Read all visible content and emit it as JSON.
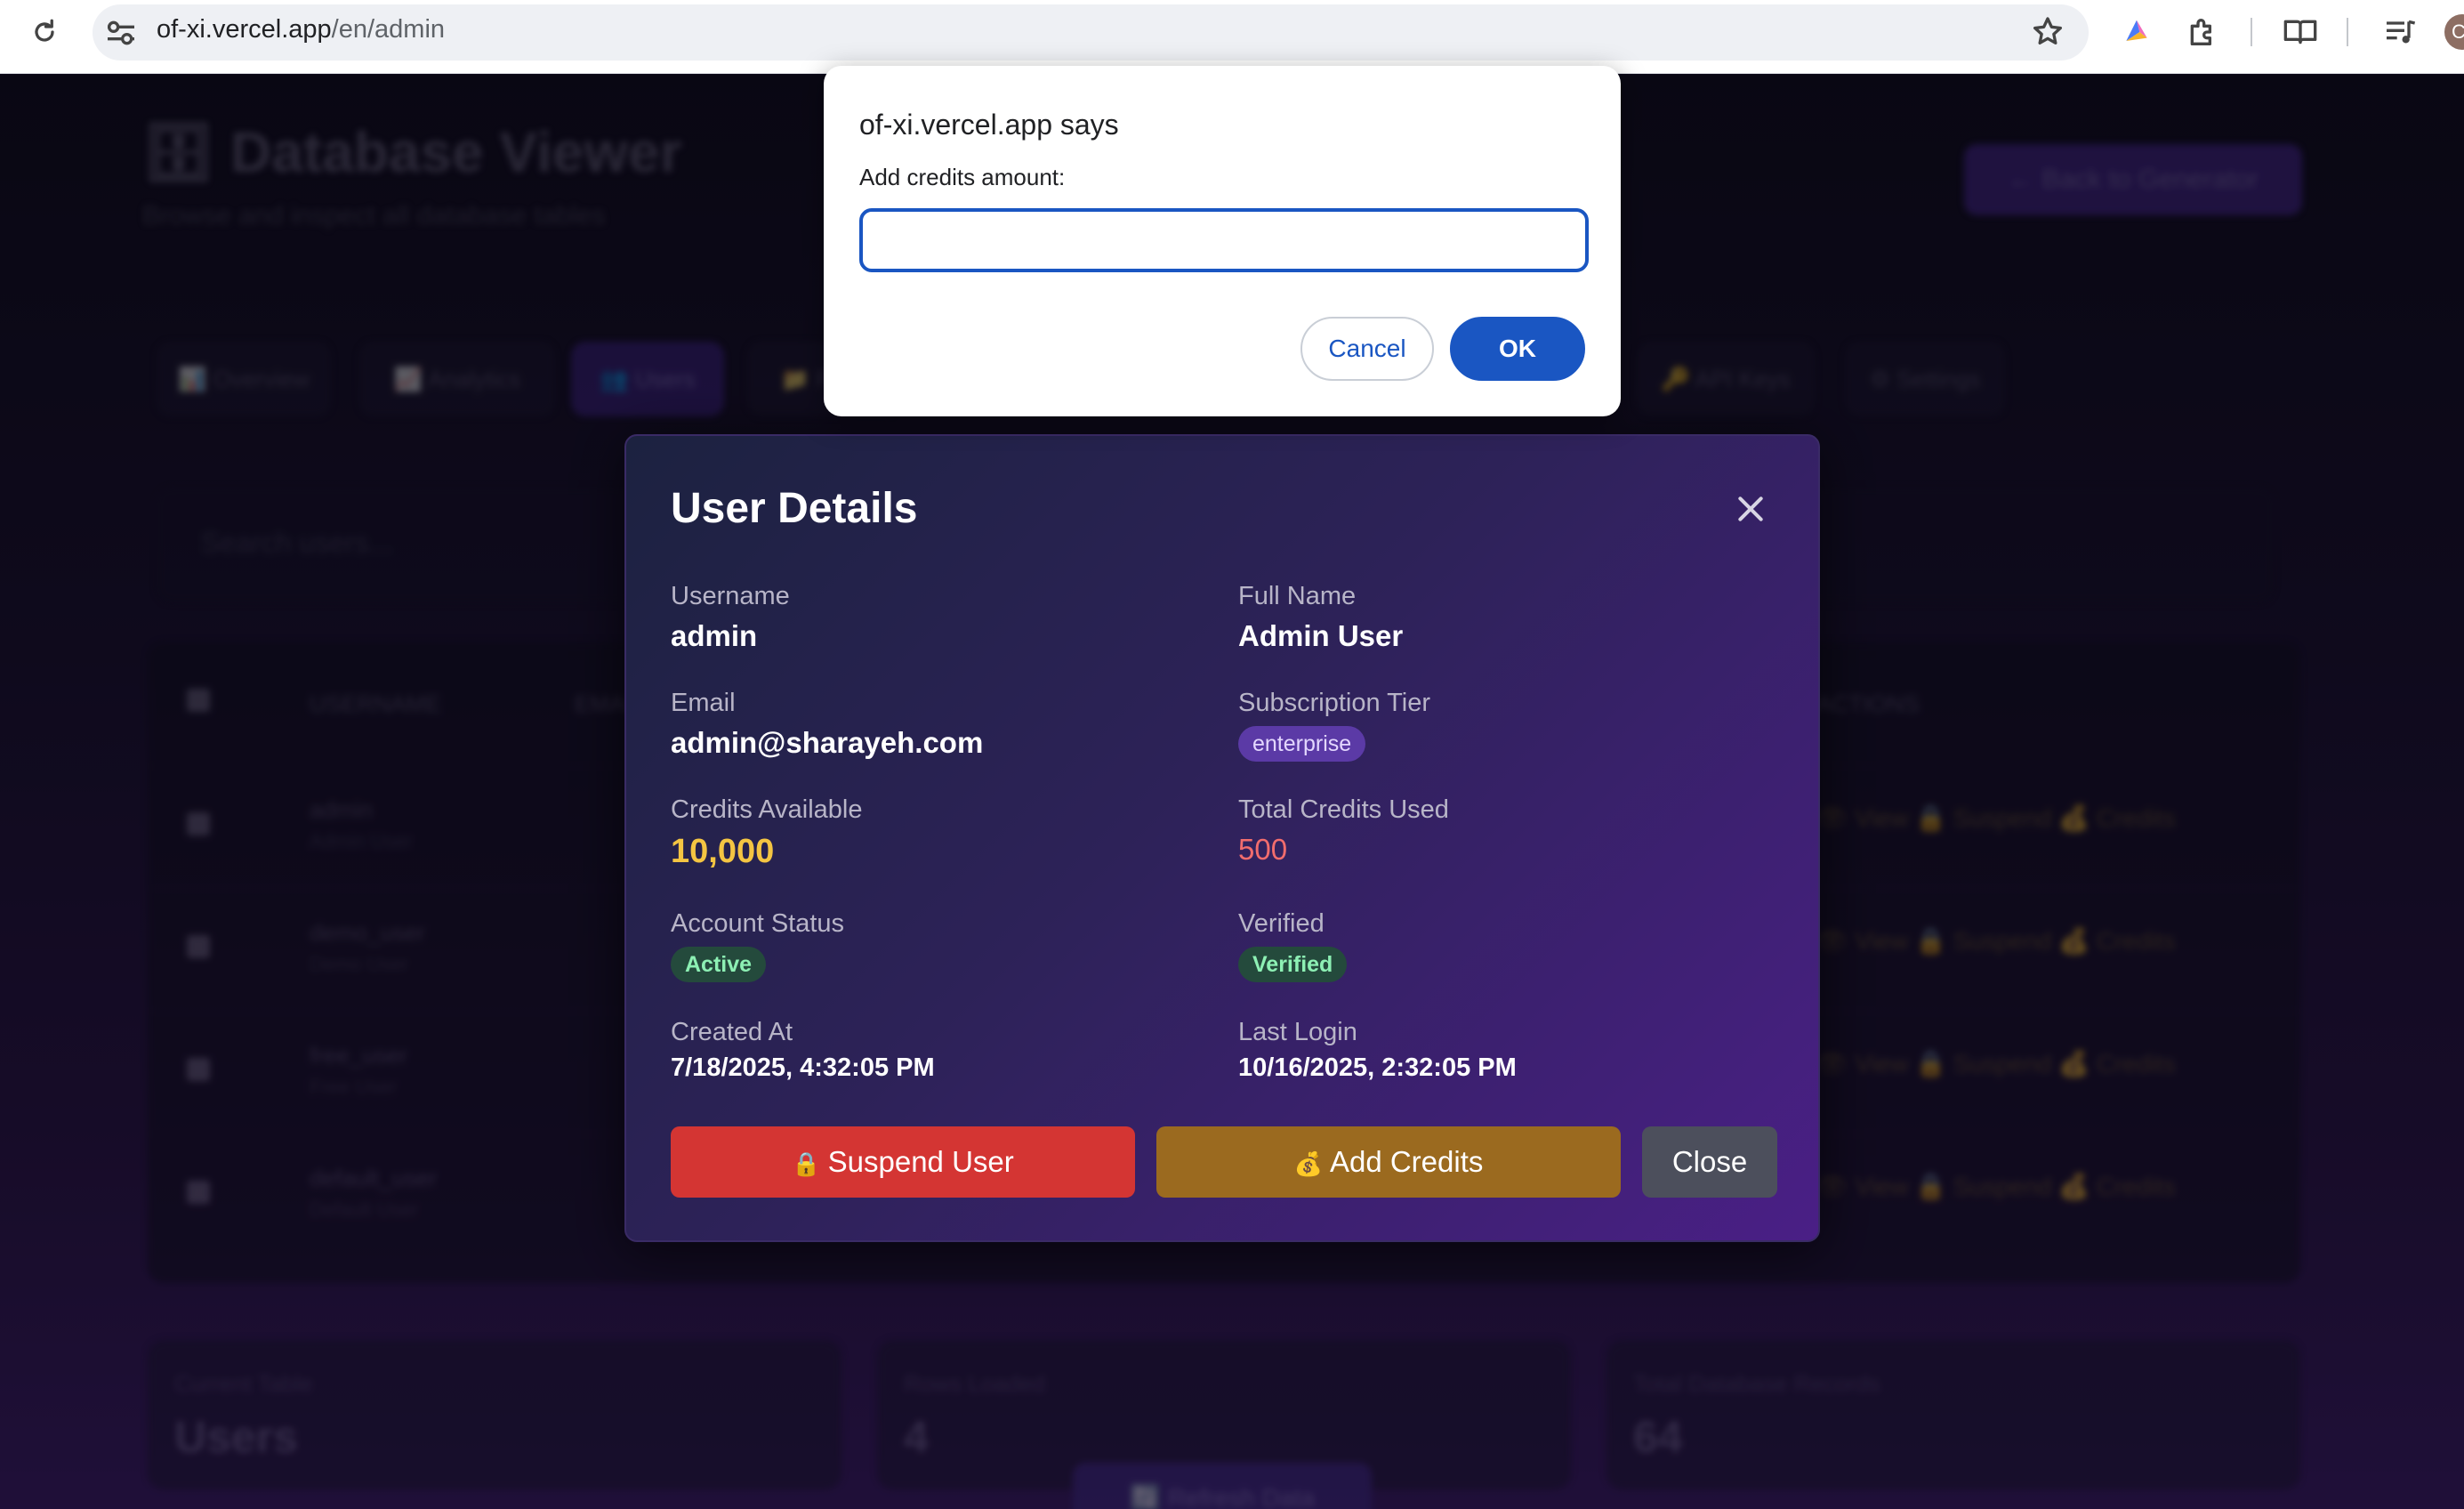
{
  "browser": {
    "url_host": "of-xi.vercel.app",
    "url_path": "/en/admin",
    "avatar_initial": "C"
  },
  "background_page": {
    "title": "🗄 Database Viewer",
    "subtitle": "Browse and inspect all database tables",
    "back_button": "← Back to Generator",
    "tabs": [
      {
        "label": "📊 Overview",
        "active": false
      },
      {
        "label": "📈 Analytics",
        "active": false
      },
      {
        "label": "👥 Users",
        "active": true
      },
      {
        "label": "📁 Files",
        "active": false
      },
      {
        "label": "🔑 API Keys",
        "active": false
      },
      {
        "label": "⚙ Settings",
        "active": false
      }
    ],
    "search_placeholder": "Search users...",
    "table_headers": [
      "USERNAME",
      "EMAIL",
      "ACTIONS"
    ],
    "rows": [
      {
        "username": "admin",
        "full_name": "Admin User"
      },
      {
        "username": "demo_user",
        "full_name": "Demo User"
      },
      {
        "username": "free_user",
        "full_name": "Free User"
      },
      {
        "username": "default_user",
        "full_name": "Default User"
      }
    ],
    "row_actions": "👁 View  🔒 Suspend  💰 Credits",
    "stats": [
      {
        "label": "Current Table",
        "value": "Users"
      },
      {
        "label": "Rows Loaded",
        "value": "4"
      },
      {
        "label": "Total Database Records",
        "value": "64"
      }
    ],
    "refresh_button": "🔄 Refresh Data"
  },
  "modal": {
    "title": "User Details",
    "fields": {
      "username": {
        "label": "Username",
        "value": "admin"
      },
      "full_name": {
        "label": "Full Name",
        "value": "Admin User"
      },
      "email": {
        "label": "Email",
        "value": "admin@sharayeh.com"
      },
      "subscription_tier": {
        "label": "Subscription Tier",
        "value": "enterprise"
      },
      "credits_available": {
        "label": "Credits Available",
        "value": "10,000"
      },
      "total_credits_used": {
        "label": "Total Credits Used",
        "value": "500"
      },
      "account_status": {
        "label": "Account Status",
        "value": "Active"
      },
      "verified": {
        "label": "Verified",
        "value": "Verified"
      },
      "created_at": {
        "label": "Created At",
        "value": "7/18/2025, 4:32:05 PM"
      },
      "last_login": {
        "label": "Last Login",
        "value": "10/16/2025, 2:32:05 PM"
      }
    },
    "buttons": {
      "suspend": {
        "icon": "🔒",
        "label": "Suspend User"
      },
      "add_credits": {
        "icon": "💰",
        "label": "Add Credits"
      },
      "close": "Close"
    }
  },
  "prompt_dialog": {
    "title": "of-xi.vercel.app says",
    "message": "Add credits amount:",
    "input_value": "",
    "cancel": "Cancel",
    "ok": "OK"
  },
  "colors": {
    "prompt_accent": "#1a56c2",
    "suspend": "#d43533",
    "add_credits": "#9b6a1f",
    "credits_available": "#f4c542",
    "credits_used": "#f26d6d",
    "badge_green": "#8df0b4"
  }
}
